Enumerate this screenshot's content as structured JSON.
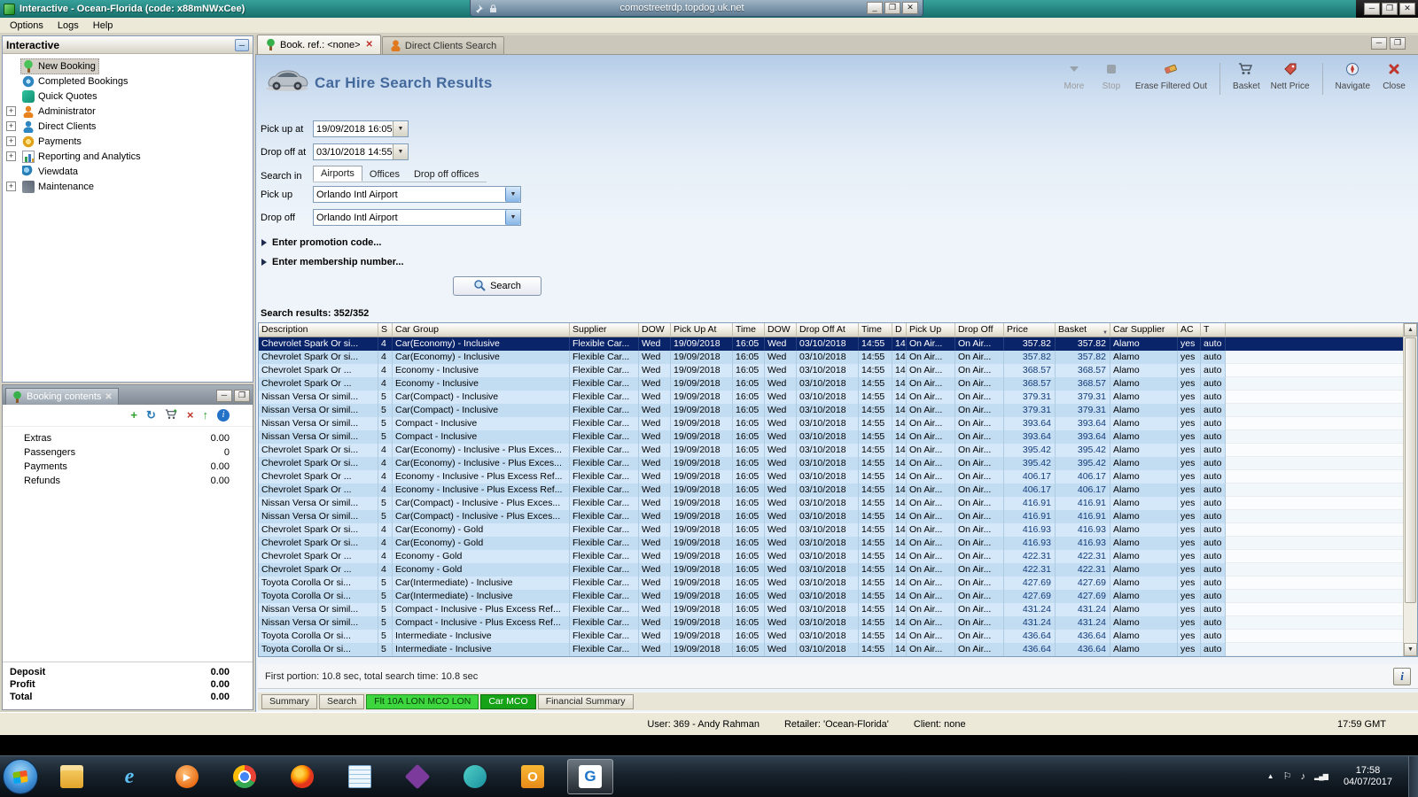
{
  "titlebar": {
    "title": "Interactive - Ocean-Florida (code: x88mNWxCee)"
  },
  "rdp": {
    "host": "comostreetrdp.topdog.uk.net"
  },
  "menubar": {
    "items": [
      "Options",
      "Logs",
      "Help"
    ]
  },
  "sidebar": {
    "title": "Interactive",
    "items": [
      {
        "label": "New Booking",
        "icon": "new-booking",
        "selected": true
      },
      {
        "label": "Completed Bookings",
        "icon": "completed-bookings"
      },
      {
        "label": "Quick Quotes",
        "icon": "quick-quotes"
      },
      {
        "label": "Administrator",
        "icon": "administrator",
        "expandable": true
      },
      {
        "label": "Direct Clients",
        "icon": "direct-clients",
        "expandable": true
      },
      {
        "label": "Payments",
        "icon": "payments",
        "expandable": true
      },
      {
        "label": "Reporting and Analytics",
        "icon": "reporting",
        "expandable": true
      },
      {
        "label": "Viewdata",
        "icon": "viewdata"
      },
      {
        "label": "Maintenance",
        "icon": "maintenance",
        "expandable": true
      }
    ]
  },
  "booking_contents": {
    "title": "Booking contents",
    "toolbar_icons": [
      "add-icon",
      "refresh-icon",
      "basket-add-icon",
      "delete-icon",
      "restore-icon",
      "info-icon"
    ],
    "rows": [
      {
        "label": "Extras",
        "value": "0.00"
      },
      {
        "label": "Passengers",
        "value": "0"
      },
      {
        "label": "Payments",
        "value": "0.00"
      },
      {
        "label": "Refunds",
        "value": "0.00"
      }
    ],
    "totals": [
      {
        "label": "Deposit",
        "value": "0.00"
      },
      {
        "label": "Profit",
        "value": "0.00"
      },
      {
        "label": "Total",
        "value": "0.00"
      }
    ]
  },
  "main": {
    "tabs": [
      {
        "label": "Book. ref.: <none>",
        "icon": "palm-tab",
        "active": true,
        "closable": true
      },
      {
        "label": "Direct Clients Search",
        "icon": "person-tab"
      }
    ],
    "title": "Car Hire Search Results",
    "toolbar": [
      {
        "label": "More",
        "icon": "more-icon",
        "disabled": true
      },
      {
        "label": "Stop",
        "icon": "stop-icon",
        "disabled": true
      },
      {
        "label": "Erase Filtered Out",
        "icon": "erase-icon"
      },
      {
        "label": "Basket",
        "icon": "basket-icon"
      },
      {
        "label": "Nett Price",
        "icon": "nett-price-icon"
      },
      {
        "label": "Navigate",
        "icon": "navigate-icon"
      },
      {
        "label": "Close",
        "icon": "close-icon"
      }
    ],
    "form": {
      "pickup_at": {
        "label": "Pick up at",
        "value": "19/09/2018 16:05"
      },
      "dropoff_at": {
        "label": "Drop off at",
        "value": "03/10/2018 14:55"
      },
      "search_in": {
        "label": "Search in",
        "options": [
          {
            "label": "Airports",
            "selected": true
          },
          {
            "label": "Offices"
          },
          {
            "label": "Drop off offices"
          }
        ]
      },
      "pickup": {
        "label": "Pick up",
        "value": "Orlando Intl Airport"
      },
      "dropoff": {
        "label": "Drop off",
        "value": "Orlando Intl Airport"
      },
      "promo_expander": "Enter promotion code...",
      "membership_expander": "Enter membership number...",
      "search_button": "Search"
    },
    "results": {
      "count_label": "Search results: 352/352",
      "columns": [
        {
          "key": "description",
          "label": "Description"
        },
        {
          "key": "s",
          "label": "S"
        },
        {
          "key": "car_group",
          "label": "Car Group"
        },
        {
          "key": "supplier",
          "label": "Supplier"
        },
        {
          "key": "dow1",
          "label": "DOW"
        },
        {
          "key": "pickup_at",
          "label": "Pick Up At"
        },
        {
          "key": "time1",
          "label": "Time"
        },
        {
          "key": "dow2",
          "label": "DOW"
        },
        {
          "key": "dropoff_at",
          "label": "Drop Off At"
        },
        {
          "key": "time2",
          "label": "Time"
        },
        {
          "key": "d",
          "label": "D"
        },
        {
          "key": "pickup",
          "label": "Pick Up"
        },
        {
          "key": "dropoff",
          "label": "Drop Off"
        },
        {
          "key": "price",
          "label": "Price"
        },
        {
          "key": "basket",
          "label": "Basket",
          "sort": true
        },
        {
          "key": "car_supplier",
          "label": "Car Supplier"
        },
        {
          "key": "ac",
          "label": "AC"
        },
        {
          "key": "t",
          "label": "T"
        }
      ],
      "common": {
        "supplier": "Flexible Car...",
        "dow1": "Wed",
        "pickup_at": "19/09/2018",
        "time1": "16:05",
        "dow2": "Wed",
        "dropoff_at": "03/10/2018",
        "time2": "14:55",
        "d": "14",
        "pickup": "On Air...",
        "dropoff": "On Air...",
        "car_supplier": "Alamo",
        "ac": "yes",
        "t": "auto"
      },
      "rows": [
        {
          "description": "Chevrolet Spark Or si...",
          "s": "4",
          "car_group": "Car(Economy) - Inclusive",
          "price": "357.82",
          "basket": "357.82",
          "selected": true
        },
        {
          "description": "Chevrolet Spark Or si...",
          "s": "4",
          "car_group": "Car(Economy) - Inclusive",
          "price": "357.82",
          "basket": "357.82"
        },
        {
          "description": "Chevrolet Spark Or ...",
          "s": "4",
          "car_group": "Economy - Inclusive",
          "price": "368.57",
          "basket": "368.57"
        },
        {
          "description": "Chevrolet Spark Or ...",
          "s": "4",
          "car_group": "Economy - Inclusive",
          "price": "368.57",
          "basket": "368.57"
        },
        {
          "description": "Nissan Versa Or simil...",
          "s": "5",
          "car_group": "Car(Compact) - Inclusive",
          "price": "379.31",
          "basket": "379.31"
        },
        {
          "description": "Nissan Versa Or simil...",
          "s": "5",
          "car_group": "Car(Compact) - Inclusive",
          "price": "379.31",
          "basket": "379.31"
        },
        {
          "description": "Nissan Versa Or simil...",
          "s": "5",
          "car_group": "Compact - Inclusive",
          "price": "393.64",
          "basket": "393.64"
        },
        {
          "description": "Nissan Versa Or simil...",
          "s": "5",
          "car_group": "Compact - Inclusive",
          "price": "393.64",
          "basket": "393.64"
        },
        {
          "description": "Chevrolet Spark Or si...",
          "s": "4",
          "car_group": "Car(Economy) - Inclusive - Plus Exces...",
          "price": "395.42",
          "basket": "395.42"
        },
        {
          "description": "Chevrolet Spark Or si...",
          "s": "4",
          "car_group": "Car(Economy) - Inclusive - Plus Exces...",
          "price": "395.42",
          "basket": "395.42"
        },
        {
          "description": "Chevrolet Spark Or ...",
          "s": "4",
          "car_group": "Economy - Inclusive - Plus Excess Ref...",
          "price": "406.17",
          "basket": "406.17"
        },
        {
          "description": "Chevrolet Spark Or ...",
          "s": "4",
          "car_group": "Economy - Inclusive - Plus Excess Ref...",
          "price": "406.17",
          "basket": "406.17"
        },
        {
          "description": "Nissan Versa Or simil...",
          "s": "5",
          "car_group": "Car(Compact) - Inclusive - Plus Exces...",
          "price": "416.91",
          "basket": "416.91"
        },
        {
          "description": "Nissan Versa Or simil...",
          "s": "5",
          "car_group": "Car(Compact) - Inclusive - Plus Exces...",
          "price": "416.91",
          "basket": "416.91"
        },
        {
          "description": "Chevrolet Spark Or si...",
          "s": "4",
          "car_group": "Car(Economy) - Gold",
          "price": "416.93",
          "basket": "416.93"
        },
        {
          "description": "Chevrolet Spark Or si...",
          "s": "4",
          "car_group": "Car(Economy) - Gold",
          "price": "416.93",
          "basket": "416.93"
        },
        {
          "description": "Chevrolet Spark Or ...",
          "s": "4",
          "car_group": "Economy - Gold",
          "price": "422.31",
          "basket": "422.31"
        },
        {
          "description": "Chevrolet Spark Or ...",
          "s": "4",
          "car_group": "Economy - Gold",
          "price": "422.31",
          "basket": "422.31"
        },
        {
          "description": "Toyota Corolla Or si...",
          "s": "5",
          "car_group": "Car(Intermediate) - Inclusive",
          "price": "427.69",
          "basket": "427.69"
        },
        {
          "description": "Toyota Corolla Or si...",
          "s": "5",
          "car_group": "Car(Intermediate) - Inclusive",
          "price": "427.69",
          "basket": "427.69"
        },
        {
          "description": "Nissan Versa Or simil...",
          "s": "5",
          "car_group": "Compact - Inclusive - Plus Excess Ref...",
          "price": "431.24",
          "basket": "431.24"
        },
        {
          "description": "Nissan Versa Or simil...",
          "s": "5",
          "car_group": "Compact - Inclusive - Plus Excess Ref...",
          "price": "431.24",
          "basket": "431.24"
        },
        {
          "description": "Toyota Corolla Or si...",
          "s": "5",
          "car_group": "Intermediate - Inclusive",
          "price": "436.64",
          "basket": "436.64"
        },
        {
          "description": "Toyota Corolla Or si...",
          "s": "5",
          "car_group": "Intermediate - Inclusive",
          "price": "436.64",
          "basket": "436.64"
        }
      ]
    },
    "status": "First portion: 10.8 sec, total search time: 10.8 sec",
    "bottom_tabs": [
      {
        "label": "Summary"
      },
      {
        "label": "Search"
      },
      {
        "label": "Flt 10A LON MCO LON",
        "style": "green"
      },
      {
        "label": "Car MCO",
        "style": "green-active"
      },
      {
        "label": "Financial Summary"
      }
    ]
  },
  "statusbar": {
    "user": "User: 369 - Andy Rahman",
    "retailer": "Retailer: 'Ocean-Florida'",
    "client": "Client: none",
    "time": "17:59 GMT"
  },
  "taskbar": {
    "apps": [
      {
        "name": "explorer"
      },
      {
        "name": "internet-explorer"
      },
      {
        "name": "media-player"
      },
      {
        "name": "chrome"
      },
      {
        "name": "firefox"
      },
      {
        "name": "notepad"
      },
      {
        "name": "visual-studio"
      },
      {
        "name": "app-teal"
      },
      {
        "name": "outlook"
      },
      {
        "name": "g-app",
        "active": true
      }
    ],
    "tray_icons": [
      "hidden-icons-icon",
      "action-center-icon",
      "volume-icon",
      "network-icon"
    ],
    "clock_time": "17:58",
    "clock_date": "04/07/2017"
  }
}
